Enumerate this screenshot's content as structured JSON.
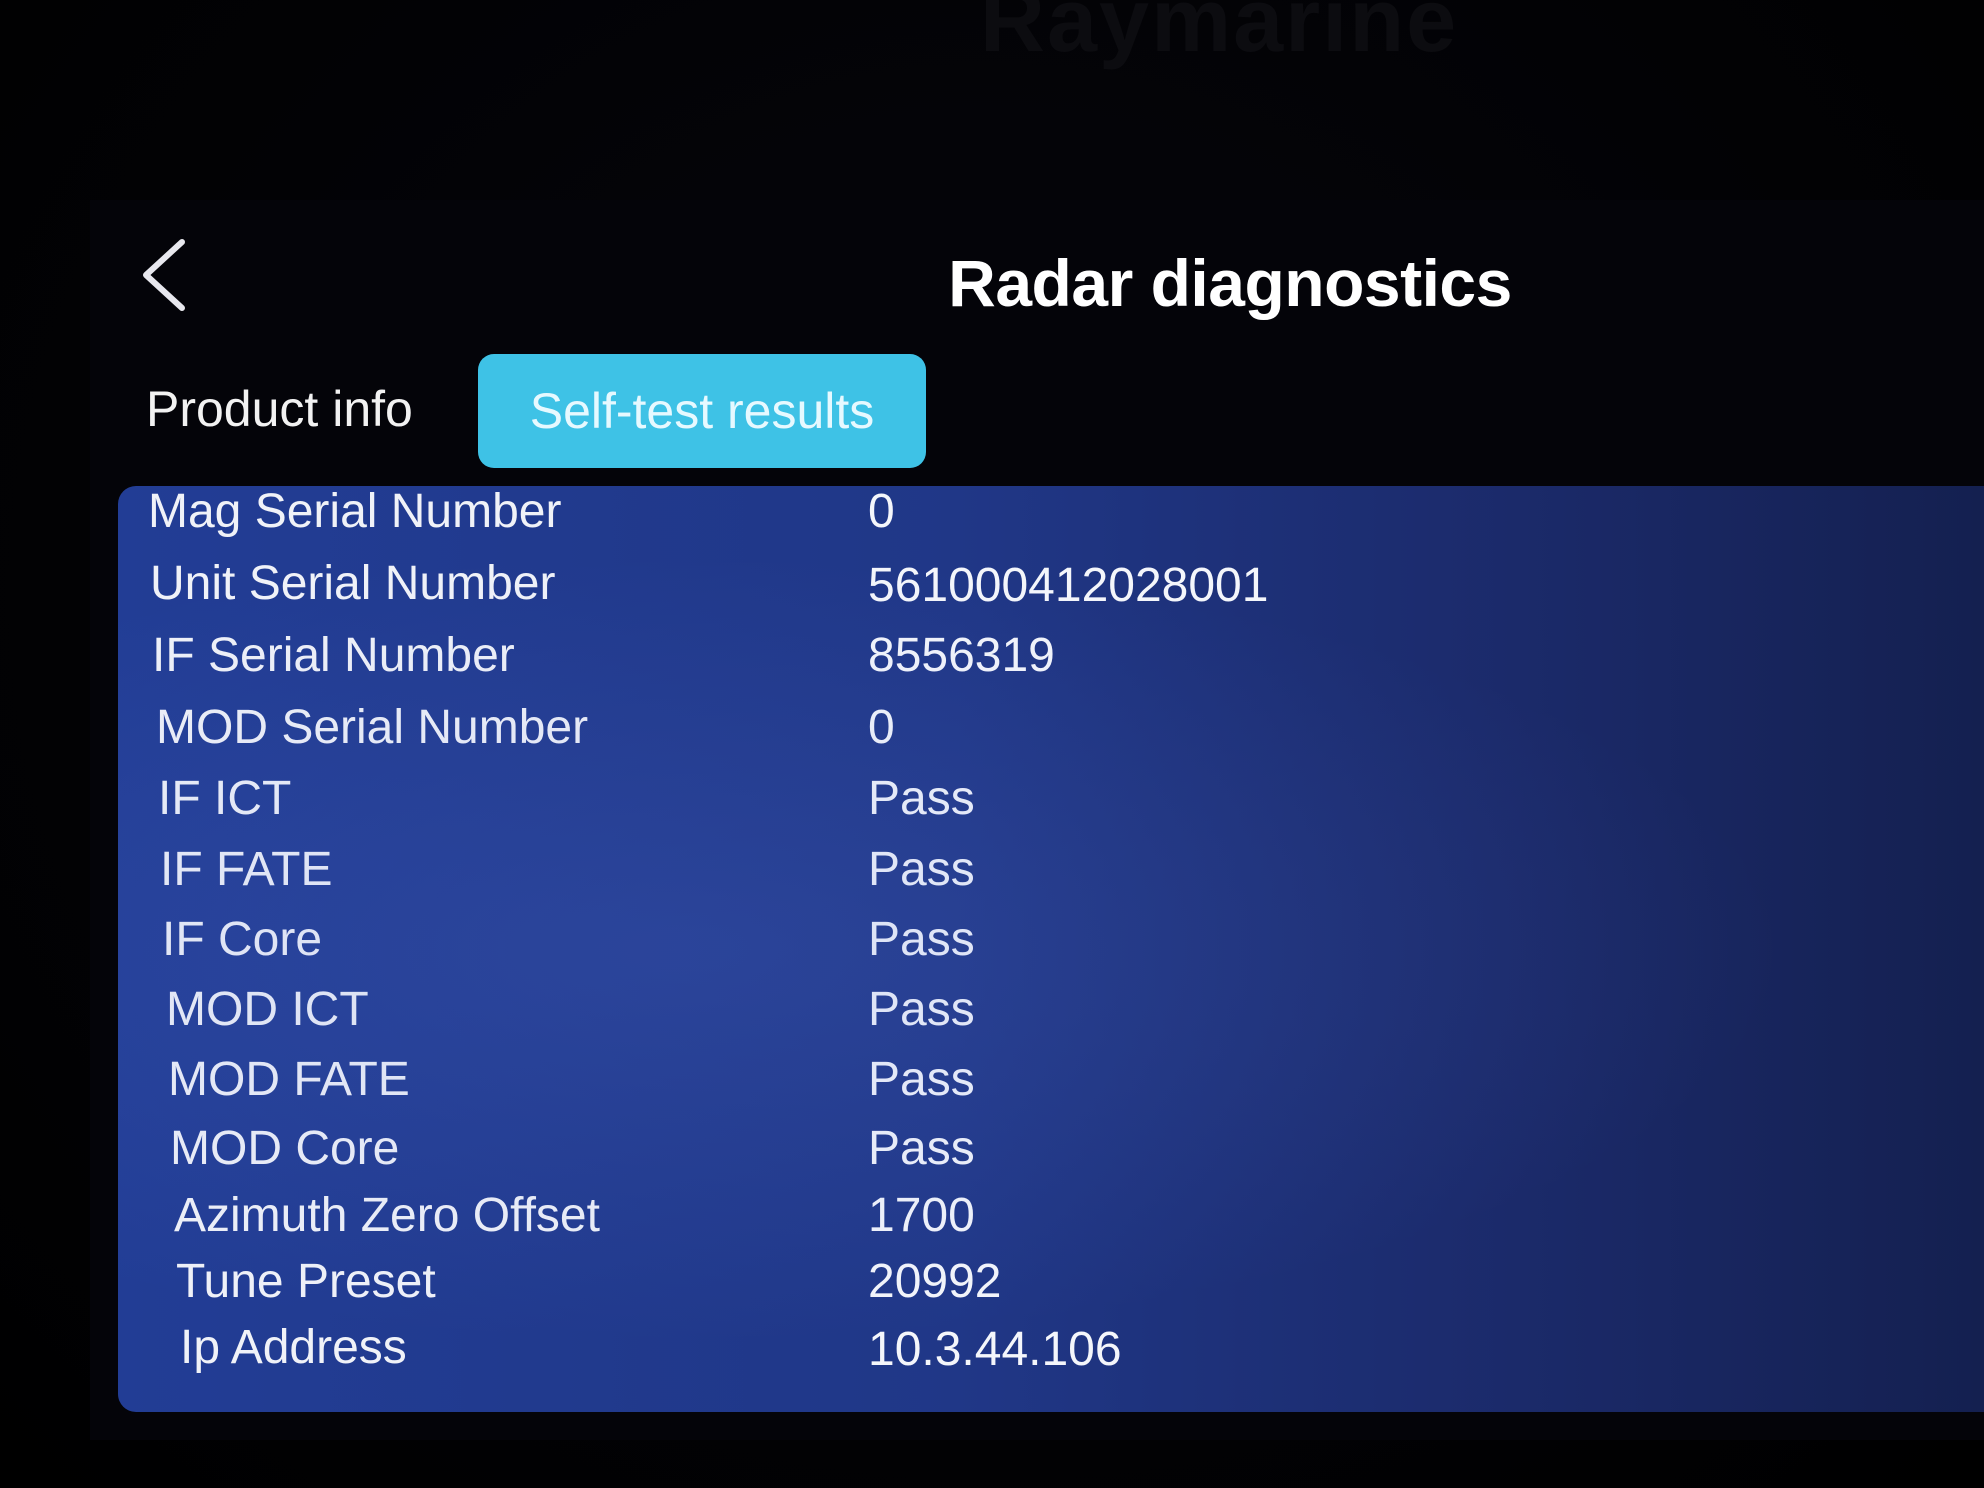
{
  "brand": "Raymarine",
  "header": {
    "title": "Radar diagnostics",
    "back_icon": "chevron-left-icon"
  },
  "tabs": [
    {
      "label": "Product info",
      "selected": false
    },
    {
      "label": "Self-test results",
      "selected": true
    }
  ],
  "colors": {
    "selected_tab": "#3ec2e6",
    "panel": "#223d95",
    "background": "#000000"
  },
  "rows": [
    {
      "label": "Mag Serial Number",
      "value": "0"
    },
    {
      "label": "Unit Serial Number",
      "value": "561000412028001"
    },
    {
      "label": "IF Serial Number",
      "value": "8556319"
    },
    {
      "label": "MOD Serial Number",
      "value": "0"
    },
    {
      "label": "IF ICT",
      "value": "Pass"
    },
    {
      "label": "IF FATE",
      "value": "Pass"
    },
    {
      "label": "IF Core",
      "value": "Pass"
    },
    {
      "label": "MOD ICT",
      "value": "Pass"
    },
    {
      "label": "MOD FATE",
      "value": "Pass"
    },
    {
      "label": "MOD Core",
      "value": "Pass"
    },
    {
      "label": "Azimuth Zero Offset",
      "value": "1700"
    },
    {
      "label": "Tune Preset",
      "value": "20992"
    },
    {
      "label": "Ip Address",
      "value": "10.3.44.106"
    }
  ]
}
